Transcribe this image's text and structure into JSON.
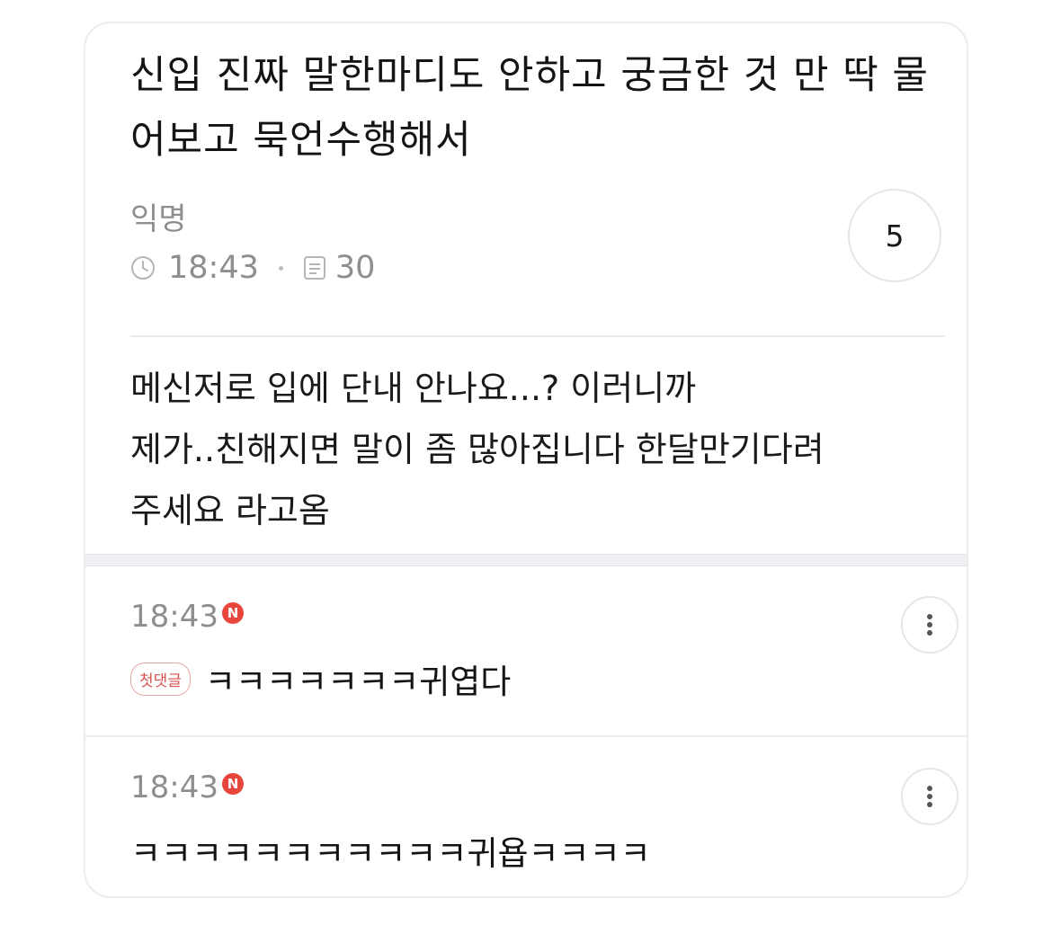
{
  "post": {
    "title": "신입 진짜 말한마디도 안하고 궁금한 것 만 딱 물어보고 묵언수행해서",
    "author": "익명",
    "time": "18:43",
    "views": "30",
    "comment_count": "5",
    "body": "메신저로 입에 단내 안나요...? 이러니까\n제가..친해지면 말이 좀 많아집니다 한달만기다려\n주세요 라고옴"
  },
  "comments": [
    {
      "time": "18:43",
      "new_badge": "N",
      "first_badge": "첫댓글",
      "text": "ㅋㅋㅋㅋㅋㅋㅋ귀엽다"
    },
    {
      "time": "18:43",
      "new_badge": "N",
      "text": "ㅋㅋㅋㅋㅋㅋㅋㅋㅋㅋㅋ귀욥ㅋㅋㅋㅋ"
    }
  ],
  "colors": {
    "muted": "#8e8e8e",
    "badge_red": "#e8453c",
    "divider": "#eef0f4"
  },
  "icons": {
    "time": "clock-icon",
    "views": "document-icon",
    "more": "more-vertical-icon"
  }
}
